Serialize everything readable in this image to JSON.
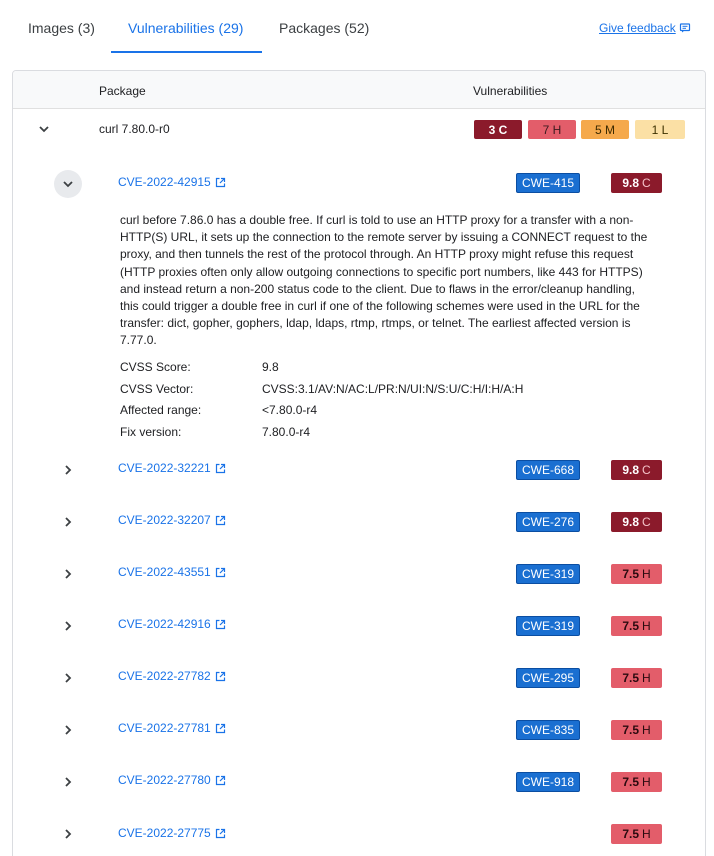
{
  "tabs": [
    {
      "label": "Images (3)"
    },
    {
      "label": "Vulnerabilities (29)"
    },
    {
      "label": "Packages (52)"
    }
  ],
  "feedback_label": "Give feedback",
  "table": {
    "col_package": "Package",
    "col_vulnerabilities": "Vulnerabilities"
  },
  "package": {
    "name": "curl 7.80.0-r0",
    "counts": {
      "critical": "3 C",
      "high": "7 H",
      "medium": "5 M",
      "low": "1 L"
    }
  },
  "expanded_cve": {
    "id": "CVE-2022-42915",
    "cwe": "CWE-415",
    "score": "9.8",
    "severity": "C",
    "description": "curl before 7.86.0 has a double free. If curl is told to use an HTTP proxy for a transfer with a non-HTTP(S) URL, it sets up the connection to the remote server by issuing a CONNECT request to the proxy, and then tunnels the rest of the protocol through. An HTTP proxy might refuse this request (HTTP proxies often only allow outgoing connections to specific port numbers, like 443 for HTTPS) and instead return a non-200 status code to the client. Due to flaws in the error/cleanup handling, this could trigger a double free in curl if one of the following schemes were used in the URL for the transfer: dict, gopher, gophers, ldap, ldaps, rtmp, rtmps, or telnet. The earliest affected version is 7.77.0.",
    "details": [
      {
        "label": "CVSS Score:",
        "value": "9.8"
      },
      {
        "label": "CVSS Vector:",
        "value": "CVSS:3.1/AV:N/AC:L/PR:N/UI:N/S:U/C:H/I:H/A:H"
      },
      {
        "label": "Affected range:",
        "value": "<7.80.0-r4"
      },
      {
        "label": "Fix version:",
        "value": "7.80.0-r4"
      }
    ]
  },
  "cves": [
    {
      "id": "CVE-2022-32221",
      "cwe": "CWE-668",
      "score": "9.8",
      "severity": "C"
    },
    {
      "id": "CVE-2022-32207",
      "cwe": "CWE-276",
      "score": "9.8",
      "severity": "C"
    },
    {
      "id": "CVE-2022-43551",
      "cwe": "CWE-319",
      "score": "7.5",
      "severity": "H"
    },
    {
      "id": "CVE-2022-42916",
      "cwe": "CWE-319",
      "score": "7.5",
      "severity": "H"
    },
    {
      "id": "CVE-2022-27782",
      "cwe": "CWE-295",
      "score": "7.5",
      "severity": "H"
    },
    {
      "id": "CVE-2022-27781",
      "cwe": "CWE-835",
      "score": "7.5",
      "severity": "H"
    },
    {
      "id": "CVE-2022-27780",
      "cwe": "CWE-918",
      "score": "7.5",
      "severity": "H"
    },
    {
      "id": "CVE-2022-27775",
      "cwe": "",
      "score": "7.5",
      "severity": "H"
    }
  ],
  "colors": {
    "accent": "#1a73e8",
    "critical": "#8b1a2b",
    "high": "#e35d6a",
    "medium": "#f5a94c",
    "low": "#fbe0a5",
    "cwe": "#1a6fd1"
  }
}
